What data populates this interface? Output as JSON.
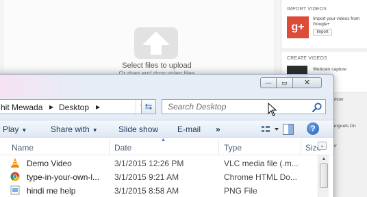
{
  "upload": {
    "select_text": "Select files to upload",
    "drag_text": "Or drag and drop video files"
  },
  "right_panel": {
    "import_heading": "IMPORT VIDEOS",
    "import_description": "Import your videos from Google+",
    "import_button": "Import",
    "create_heading": "CREATE VIDEOS",
    "webcam_label": "Webcam capture",
    "side_labels": [
      "show",
      "angouts On",
      "er"
    ]
  },
  "window": {
    "breadcrumb": [
      "hit Mewada",
      "Desktop"
    ],
    "search_placeholder": "Search Desktop",
    "minimize_glyph": "—",
    "maximize_glyph": "▭",
    "close_glyph": "✕"
  },
  "toolbar": {
    "play": "Play",
    "share_with": "Share with",
    "slide_show": "Slide show",
    "email": "E-mail",
    "more": "»"
  },
  "columns": {
    "name": "Name",
    "date": "Date",
    "type": "Type",
    "size": "Size"
  },
  "files": [
    {
      "name": "Demo Video",
      "date": "3/1/2015 12:26 PM",
      "type": "VLC media file (.m...",
      "icon": "vlc-icon"
    },
    {
      "name": "type-in-your-own-l...",
      "date": "3/1/2015 9:21 AM",
      "type": "Chrome HTML Do...",
      "icon": "chrome-icon"
    },
    {
      "name": "hindi me help",
      "date": "3/1/2015 8:58 AM",
      "type": "PNG File",
      "icon": "png-file-icon"
    }
  ],
  "colors": {
    "accent": "#2a63b0",
    "gplus": "#dd4b39",
    "vlc": "#f28b00"
  }
}
